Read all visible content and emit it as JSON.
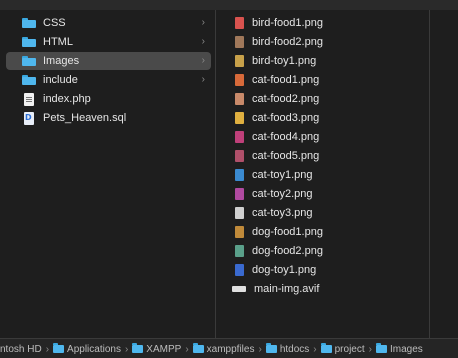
{
  "column1": {
    "items": [
      {
        "label": "CSS",
        "type": "folder",
        "icon": "folder-icon",
        "selected": false
      },
      {
        "label": "HTML",
        "type": "folder",
        "icon": "folder-icon",
        "selected": false
      },
      {
        "label": "Images",
        "type": "folder",
        "icon": "folder-icon",
        "selected": true
      },
      {
        "label": "include",
        "type": "folder",
        "icon": "folder-icon",
        "selected": false
      },
      {
        "label": "index.php",
        "type": "file",
        "icon": "php-file-icon",
        "selected": false
      },
      {
        "label": "Pets_Heaven.sql",
        "type": "file",
        "icon": "sql-file-icon",
        "selected": false
      }
    ],
    "chevron": "›"
  },
  "column2": {
    "items": [
      {
        "label": "bird-food1.png",
        "icon": "image-thumbnail-icon",
        "color": "#d9534f"
      },
      {
        "label": "bird-food2.png",
        "icon": "image-thumbnail-icon",
        "color": "#a0785a"
      },
      {
        "label": "bird-toy1.png",
        "icon": "image-thumbnail-icon",
        "color": "#c8a14a"
      },
      {
        "label": "cat-food1.png",
        "icon": "image-thumbnail-icon",
        "color": "#d86a3a"
      },
      {
        "label": "cat-food2.png",
        "icon": "image-thumbnail-icon",
        "color": "#c98a6a"
      },
      {
        "label": "cat-food3.png",
        "icon": "image-thumbnail-icon",
        "color": "#e0b040"
      },
      {
        "label": "cat-food4.png",
        "icon": "image-thumbnail-icon",
        "color": "#c0407a"
      },
      {
        "label": "cat-food5.png",
        "icon": "image-thumbnail-icon",
        "color": "#b0506a"
      },
      {
        "label": "cat-toy1.png",
        "icon": "image-thumbnail-icon",
        "color": "#3a8ad0"
      },
      {
        "label": "cat-toy2.png",
        "icon": "image-thumbnail-icon",
        "color": "#b04aa0"
      },
      {
        "label": "cat-toy3.png",
        "icon": "image-thumbnail-icon",
        "color": "#d0d0d0"
      },
      {
        "label": "dog-food1.png",
        "icon": "image-thumbnail-icon",
        "color": "#c08a3a"
      },
      {
        "label": "dog-food2.png",
        "icon": "image-thumbnail-icon",
        "color": "#5aa08a"
      },
      {
        "label": "dog-toy1.png",
        "icon": "image-thumbnail-icon",
        "color": "#3a6ad0"
      },
      {
        "label": "main-img.avif",
        "icon": "avif-file-icon",
        "color": "#e0e0e0"
      }
    ]
  },
  "pathbar": {
    "crumbs": [
      {
        "label": "ntosh HD",
        "icon": null
      },
      {
        "label": "Applications",
        "icon": "folder-icon"
      },
      {
        "label": "XAMPP",
        "icon": "folder-icon"
      },
      {
        "label": "xamppfiles",
        "icon": "folder-icon"
      },
      {
        "label": "htdocs",
        "icon": "folder-icon"
      },
      {
        "label": "project",
        "icon": "folder-icon"
      },
      {
        "label": "Images",
        "icon": "folder-icon"
      }
    ],
    "separator": "›"
  },
  "colors": {
    "background": "#1e1e1e",
    "selection": "#4a4a4a",
    "folder": "#4fb7ee",
    "text": "#e6e6e6"
  }
}
